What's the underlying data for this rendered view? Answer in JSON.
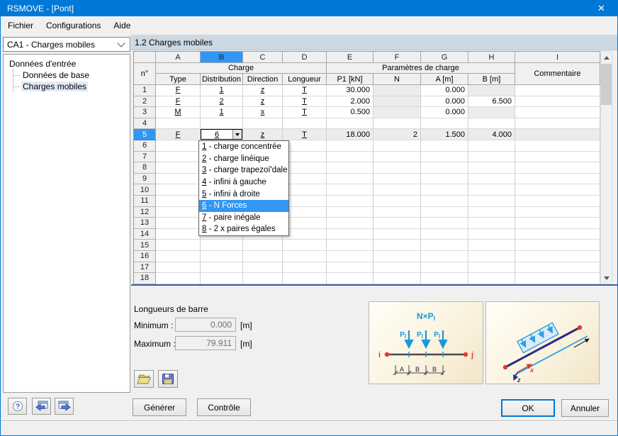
{
  "window": {
    "title": "RSMOVE - [Pont]",
    "close_glyph": "✕"
  },
  "menu": {
    "items": [
      "Fichier",
      "Configurations",
      "Aide"
    ]
  },
  "sidebar": {
    "combo_value": "CA1 - Charges mobiles",
    "tree": {
      "root": "Données d'entrée",
      "children": [
        "Données de base",
        "Charges mobiles"
      ],
      "selected": "Charges mobiles"
    }
  },
  "section": {
    "title": "1.2 Charges mobiles"
  },
  "table": {
    "row_header": "n°",
    "col_letters": [
      "A",
      "B",
      "C",
      "D",
      "E",
      "F",
      "G",
      "H",
      "I"
    ],
    "selected_col_letter": "B",
    "group_headers": {
      "charge": "Charge",
      "params": "Paramètres de charge"
    },
    "columns": [
      "Type",
      "Distribution",
      "Direction",
      "Longueur",
      "P1 [kN]",
      "N",
      "A [m]",
      "B [m]",
      "Commentaire"
    ],
    "selected_row": "5",
    "rows": [
      {
        "n": "1",
        "type": "F",
        "dist": "1",
        "dir": "z",
        "len": "T",
        "p1": "30.000",
        "N": "",
        "A": "0.000",
        "B": "",
        "comment": "",
        "gray": [
          "N",
          "B"
        ]
      },
      {
        "n": "2",
        "type": "F",
        "dist": "2",
        "dir": "z",
        "len": "T",
        "p1": "2.000",
        "N": "",
        "A": "0.000",
        "B": "6.500",
        "comment": "",
        "gray": [
          "N"
        ]
      },
      {
        "n": "3",
        "type": "M",
        "dist": "1",
        "dir": "x",
        "len": "T",
        "p1": "0.500",
        "N": "",
        "A": "0.000",
        "B": "",
        "comment": "",
        "gray": [
          "N",
          "B"
        ]
      },
      {
        "n": "4"
      },
      {
        "n": "5",
        "type": "F",
        "dist": "6",
        "dir": "z",
        "len": "T",
        "p1": "18.000",
        "N": "2",
        "A": "1.500",
        "B": "4.000",
        "comment": "",
        "selected": true,
        "combo": true
      },
      {
        "n": "6"
      },
      {
        "n": "7"
      },
      {
        "n": "8"
      },
      {
        "n": "9"
      },
      {
        "n": "10"
      },
      {
        "n": "11"
      },
      {
        "n": "12"
      },
      {
        "n": "13"
      },
      {
        "n": "14"
      },
      {
        "n": "15"
      },
      {
        "n": "16"
      },
      {
        "n": "17"
      },
      {
        "n": "18"
      }
    ]
  },
  "dropdown": {
    "value": "6",
    "selected_index": 5,
    "items": [
      {
        "num": "1",
        "label": "charge concentrée"
      },
      {
        "num": "2",
        "label": "charge linéique"
      },
      {
        "num": "3",
        "label": "charge trapezoï'dale"
      },
      {
        "num": "4",
        "label": "infini à gauche"
      },
      {
        "num": "5",
        "label": "infini à droite"
      },
      {
        "num": "6",
        "label": "N Forces"
      },
      {
        "num": "7",
        "label": "paire inégale"
      },
      {
        "num": "8",
        "label": "2 x paires égales"
      }
    ]
  },
  "footer_panel": {
    "group_title": "Longueurs de barre",
    "min_label": "Minimum :",
    "min_value": "0.000",
    "min_unit": "[m]",
    "max_label": "Maximum :",
    "max_value": "79.911",
    "max_unit": "[m]"
  },
  "diagram": {
    "force_label": "N×P",
    "force_sub": "l",
    "p_label": "P",
    "p_sub": "l",
    "node_i": "i",
    "node_j": "j",
    "dim_a": "A",
    "dim_b1": "B",
    "dim_b2": "B",
    "axis_x": "x",
    "axis_z": "z"
  },
  "buttons": {
    "generate": "Générer",
    "check": "Contrôle",
    "ok": "OK",
    "cancel": "Annuler"
  },
  "colors": {
    "titlebar": "#0078d7",
    "selection_blue": "#3296f2",
    "section_header_bg": "#ccd9e3",
    "disabled_cell": "#ececec",
    "diagram_blue": "#1899d6",
    "diagram_red": "#e23a2e",
    "diagram_navy": "#2d2b7f"
  }
}
